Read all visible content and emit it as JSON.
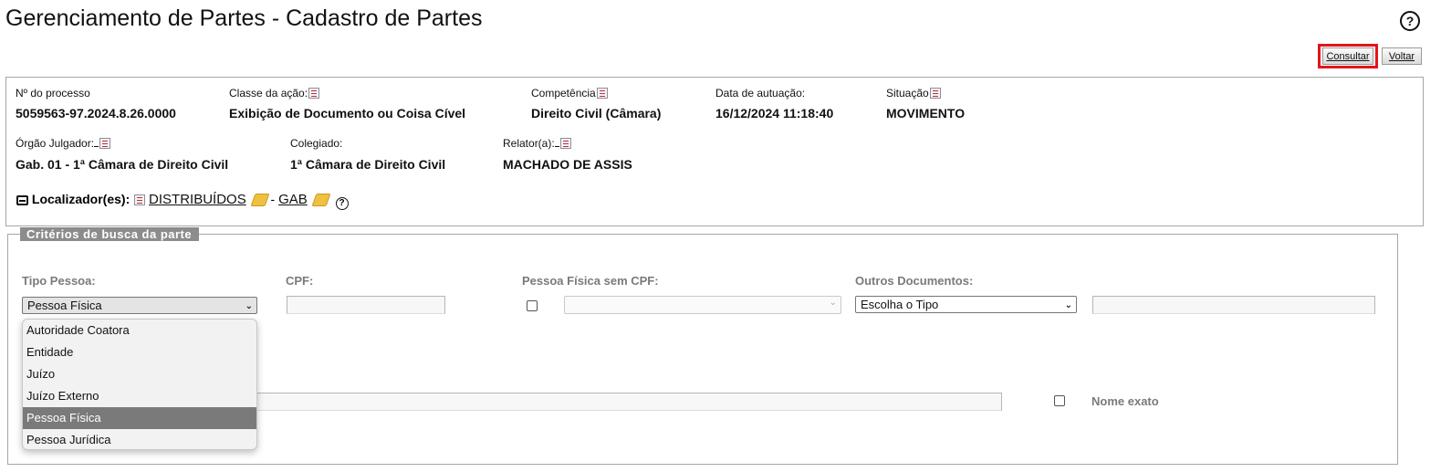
{
  "header": {
    "title": "Gerenciamento de Partes - Cadastro de Partes",
    "help_symbol": "?"
  },
  "toolbar": {
    "consultar_label": "Consultar",
    "voltar_label": "Voltar"
  },
  "process": {
    "numero_label": "Nº do processo",
    "numero_value": "5059563-97.2024.8.26.0000",
    "classe_label": "Classe da ação:",
    "classe_value": "Exibição de Documento ou Coisa Cível",
    "competencia_label": "Competência",
    "competencia_value": "Direito Civil (Câmara)",
    "data_label": "Data de autuação:",
    "data_value": "16/12/2024 11:18:40",
    "situacao_label": "Situação",
    "situacao_value": "MOVIMENTO",
    "orgao_label": "Órgão Julgador:",
    "orgao_value": "Gab. 01 - 1ª Câmara de Direito Civil",
    "colegiado_label": "Colegiado:",
    "colegiado_value": "1ª Câmara de Direito Civil",
    "relator_label": "Relator(a):",
    "relator_value": "MACHADO DE ASSIS",
    "localizador_label": "Localizador(es):",
    "localizador_1": "DISTRIBUÍDOS",
    "localizador_sep": "-",
    "localizador_2": "GAB",
    "help_symbol": "?"
  },
  "search": {
    "legend": "Critérios de busca da parte",
    "tipo_pessoa_label": "Tipo Pessoa:",
    "tipo_pessoa_selected": "Pessoa Física",
    "tipo_pessoa_options": [
      "Autoridade Coatora",
      "Entidade",
      "Juízo",
      "Juízo Externo",
      "Pessoa Física",
      "Pessoa Jurídica"
    ],
    "cpf_label": "CPF:",
    "pessoa_sem_cpf_label": "Pessoa Física sem CPF:",
    "outros_documentos_label": "Outros Documentos:",
    "outros_documentos_selected": "Escolha o Tipo",
    "nome_exato_label": "Nome exato"
  },
  "colors": {
    "highlight_border": "#e4141b",
    "legend_bg": "#8c8c8c",
    "selected_option_bg": "#7a7a7a"
  }
}
